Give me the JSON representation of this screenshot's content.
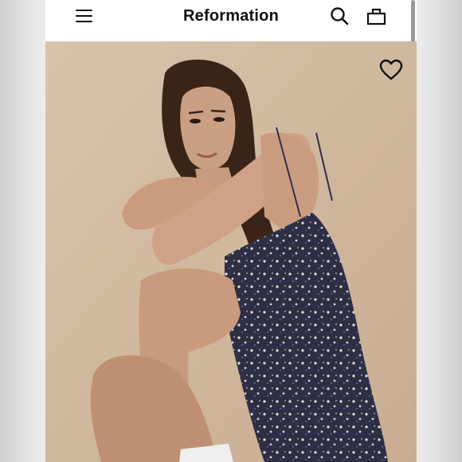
{
  "header": {
    "brand": "Reformation",
    "icons": [
      "menu-icon",
      "search-icon",
      "bag-icon"
    ]
  },
  "product": {
    "image": "model-in-floral-mini-dress",
    "icons": [
      "heart-icon"
    ]
  },
  "colors": {
    "header_bg": "#ffffff",
    "photo_bg": "#d2bba1",
    "dress": "#2e2f45",
    "text": "#111111"
  }
}
